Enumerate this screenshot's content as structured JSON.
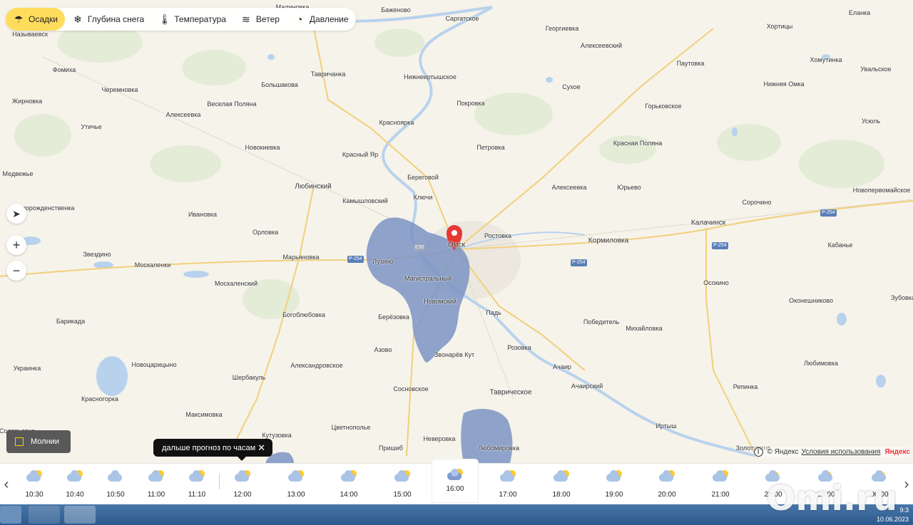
{
  "layers": [
    {
      "label": "Осадки",
      "icon": "rain-cloud-icon",
      "active": true
    },
    {
      "label": "Глубина снега",
      "icon": "snowflake-icon"
    },
    {
      "label": "Температура",
      "icon": "thermometer-icon"
    },
    {
      "label": "Ветер",
      "icon": "wind-icon"
    },
    {
      "label": "Давление",
      "icon": "gauge-icon"
    }
  ],
  "places": [
    "Называевск",
    "Малиновка",
    "Баженово",
    "Саргатское",
    "Георгиевка",
    "Еланка",
    "Хортицы",
    "Фомиха",
    "Черемновка",
    "Жирновка",
    "Алексеевка",
    "Утичье",
    "Тавричанка",
    "Большакова",
    "Веселая Поляна",
    "Нижнеиртышское",
    "Алексеевский",
    "Паутовка",
    "Хомутинка",
    "Увальское",
    "Нижняя Омка",
    "Сухое",
    "Покровка",
    "Горьковское",
    "Красноярка",
    "Усюль",
    "Новокиевка",
    "Петровка",
    "Красная Поляна",
    "Красный Яр",
    "Медвежье",
    "Береговой",
    "Любинский",
    "Ключи",
    "Алексеевка",
    "Юрьево",
    "Камышловский",
    "Новопервомайское",
    "Новорожденственка",
    "Ивановка",
    "Сорочино",
    "Орловка",
    "Ростовка",
    "Калачинск",
    "Кормиловка",
    "Омск",
    "Звездино",
    "Марьяновка",
    "Лузино",
    "Кабанье",
    "Москаленки",
    "Магистральный",
    "Москаленский",
    "Осокино",
    "Новомский",
    "Зубовка",
    "Богоблюбовка",
    "Падь",
    "Оконешниково",
    "Барикада",
    "Берёзовка",
    "Победитель",
    "Михайловка",
    "Азово",
    "Звонарёв Кут",
    "Розовка",
    "Украинка",
    "Новоцарицыно",
    "Александровское",
    "Ачаир",
    "Любимовка",
    "Шербакуль",
    "Сосновское",
    "Ачаирский",
    "Таврическое",
    "Репинка",
    "Красногорка",
    "Максимовка",
    "Иртыш",
    "Соловьевка",
    "Кутузовка",
    "Цветнополье",
    "Неверовка",
    "Пришиб",
    "Любомировка",
    "Золотухино"
  ],
  "roads": [
    "Р-254",
    "Р-254",
    "Р-254",
    "Р-254",
    "E30"
  ],
  "controls": {
    "locate": "location-arrow-icon",
    "zoom_in": "+",
    "zoom_out": "−"
  },
  "lightning": {
    "label": "Молнии"
  },
  "tooltip": {
    "text": "дальше прогноз по часам"
  },
  "copyright": {
    "text": "© Яндекс",
    "link": "Условия использования",
    "brand": "Яндекс"
  },
  "timeline": [
    {
      "time": "10:30",
      "icon": "partly-cloudy-icon"
    },
    {
      "time": "10:40",
      "icon": "partly-cloudy-icon"
    },
    {
      "time": "10:50",
      "icon": "cloudy-icon"
    },
    {
      "time": "11:00",
      "icon": "partly-cloudy-icon"
    },
    {
      "time": "11:10",
      "icon": "partly-cloudy-icon"
    },
    {
      "time": "12:00",
      "icon": "partly-cloudy-icon"
    },
    {
      "time": "13:00",
      "icon": "partly-cloudy-icon"
    },
    {
      "time": "14:00",
      "icon": "partly-cloudy-icon"
    },
    {
      "time": "15:00",
      "icon": "partly-cloudy-icon"
    },
    {
      "time": "16:00",
      "icon": "rain-icon",
      "current": true
    },
    {
      "time": "17:00",
      "icon": "partly-cloudy-icon"
    },
    {
      "time": "18:00",
      "icon": "partly-cloudy-icon"
    },
    {
      "time": "19:00",
      "icon": "partly-cloudy-icon"
    },
    {
      "time": "20:00",
      "icon": "partly-cloudy-icon"
    },
    {
      "time": "21:00",
      "icon": "partly-cloudy-icon"
    },
    {
      "time": "22:00",
      "icon": "partly-cloudy-night-icon"
    },
    {
      "time": "23:00",
      "icon": "partly-cloudy-night-icon"
    },
    {
      "time": "00:00",
      "icon": "partly-cloudy-night-icon"
    }
  ],
  "watermark": "Omi.ru",
  "clock": {
    "time": "9:3",
    "date": "10.06.2023"
  },
  "colors": {
    "precip": "#7b93c4",
    "active_tab": "#ffdc5c",
    "river": "#b8d2ee",
    "road": "#f5d27a",
    "pin": "#e53935"
  }
}
